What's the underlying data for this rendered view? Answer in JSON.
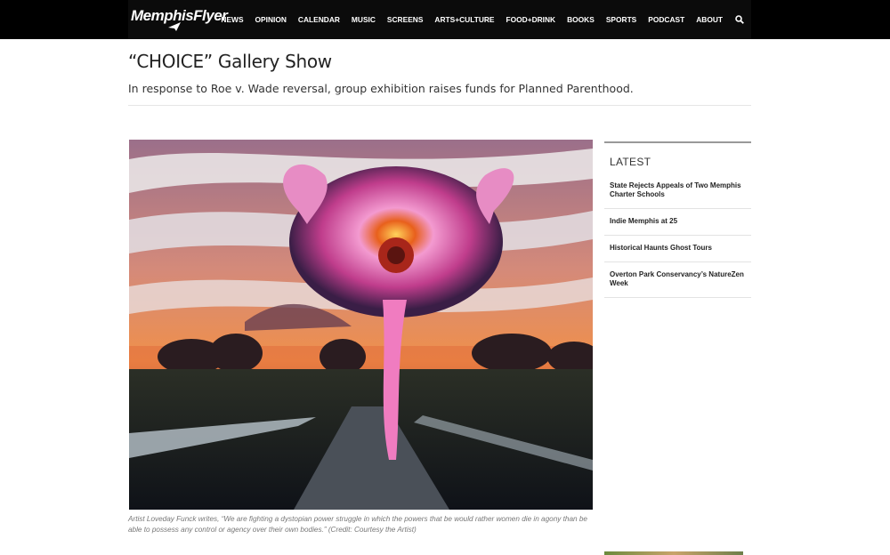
{
  "site": {
    "logo": "MemphisFlyer"
  },
  "nav": {
    "items": [
      "NEWS",
      "OPINION",
      "CALENDAR",
      "MUSIC",
      "SCREENS",
      "ARTS+CULTURE",
      "FOOD+DRINK",
      "BOOKS",
      "SPORTS",
      "PODCAST",
      "ABOUT"
    ],
    "search_icon": "search-icon"
  },
  "article": {
    "title": "“CHOICE” Gallery Show",
    "dek": "In response to Roe v. Wade reversal, group exhibition raises funds for Planned Parenthood.",
    "caption": "Artist Loveday Funck writes, “We are fighting a dystopian power struggle in which the powers that be would rather women die in agony than be able to possess any control or agency over their own bodies.” (Credit: Courtesy the Artist)"
  },
  "sidebar": {
    "heading": "LATEST",
    "items": [
      "State Rejects Appeals of Two Memphis Charter Schools",
      "Indie Memphis at 25",
      "Historical Haunts Ghost Tours",
      "Overton Park Conservancy’s NatureZen Week"
    ]
  }
}
